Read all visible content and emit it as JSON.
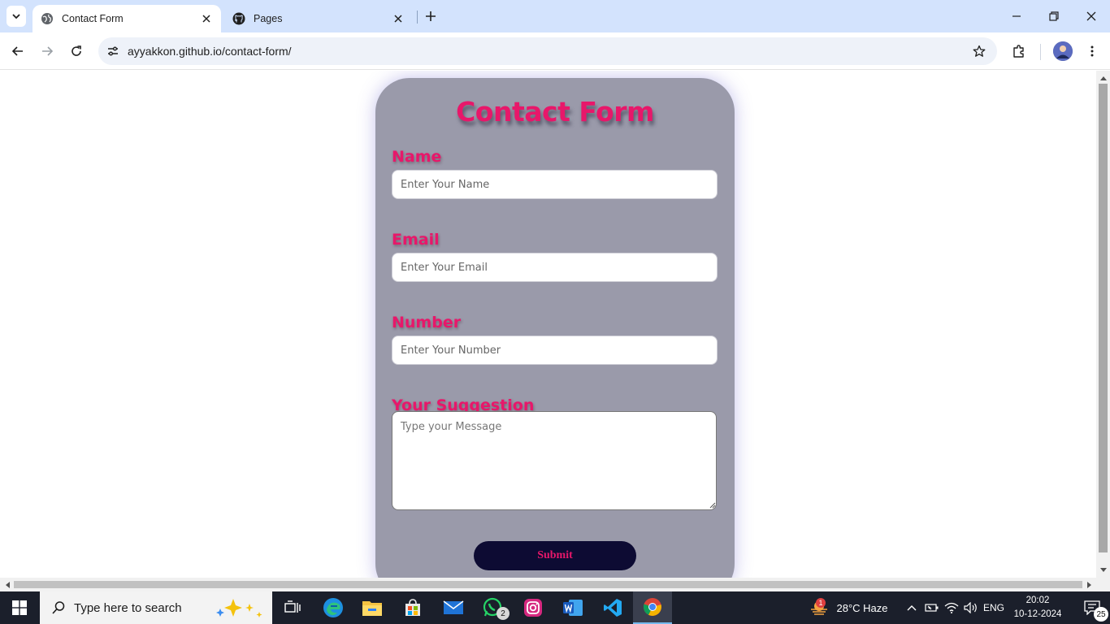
{
  "browser": {
    "tabs": [
      {
        "title": "Contact Form",
        "favicon": "globe-icon",
        "active": true
      },
      {
        "title": "Pages",
        "favicon": "github-icon",
        "active": false
      }
    ],
    "url": "ayyakkon.github.io/contact-form/"
  },
  "form": {
    "heading": "Contact Form",
    "name_label": "Name",
    "name_placeholder": "Enter Your Name",
    "email_label": "Email",
    "email_placeholder": "Enter Your Email",
    "number_label": "Number",
    "number_placeholder": "Enter Your Number",
    "suggestion_label": "Your Suggestion",
    "message_placeholder": "Type your Message",
    "submit_label": "Submit"
  },
  "taskbar": {
    "search_placeholder": "Type here to search",
    "whatsapp_badge": "2",
    "weather_badge": "1",
    "weather": "28°C  Haze",
    "language": "ENG",
    "time": "20:02",
    "date": "10-12-2024",
    "notification_count": "25"
  },
  "colors": {
    "accent": "#e8176a",
    "card": "#9a9aaa",
    "button": "#0d0b33",
    "tabbar": "#d3e3fd"
  }
}
